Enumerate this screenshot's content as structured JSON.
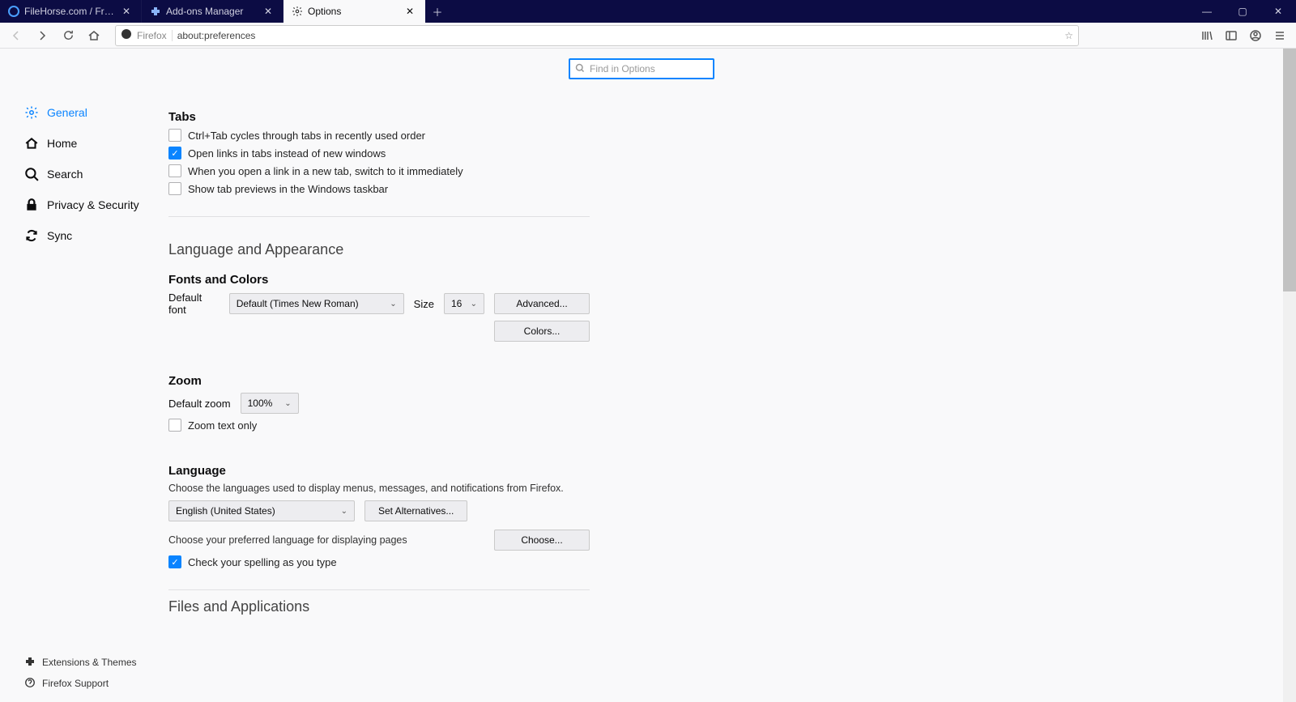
{
  "tabs": [
    {
      "label": "FileHorse.com / Free Software …",
      "active": false
    },
    {
      "label": "Add-ons Manager",
      "active": false
    },
    {
      "label": "Options",
      "active": true
    }
  ],
  "urlbar": {
    "identity": "Firefox",
    "url": "about:preferences"
  },
  "search": {
    "placeholder": "Find in Options"
  },
  "sidebar": [
    {
      "label": "General",
      "active": true
    },
    {
      "label": "Home"
    },
    {
      "label": "Search"
    },
    {
      "label": "Privacy & Security"
    },
    {
      "label": "Sync"
    }
  ],
  "bottomlinks": [
    {
      "label": "Extensions & Themes"
    },
    {
      "label": "Firefox Support"
    }
  ],
  "tabs_section": {
    "title": "Tabs",
    "items": [
      {
        "checked": false,
        "label": "Ctrl+Tab cycles through tabs in recently used order"
      },
      {
        "checked": true,
        "label": "Open links in tabs instead of new windows"
      },
      {
        "checked": false,
        "label": "When you open a link in a new tab, switch to it immediately"
      },
      {
        "checked": false,
        "label": "Show tab previews in the Windows taskbar"
      }
    ]
  },
  "lang_appearance": {
    "title": "Language and Appearance"
  },
  "fonts": {
    "title": "Fonts and Colors",
    "default_font_label": "Default font",
    "default_font_value": "Default (Times New Roman)",
    "size_label": "Size",
    "size_value": "16",
    "advanced": "Advanced...",
    "colors": "Colors..."
  },
  "zoom": {
    "title": "Zoom",
    "default_zoom_label": "Default zoom",
    "default_zoom_value": "100%",
    "text_only_checked": false,
    "text_only_label": "Zoom text only"
  },
  "language": {
    "title": "Language",
    "desc1": "Choose the languages used to display menus, messages, and notifications from Firefox.",
    "lang_value": "English (United States)",
    "set_alt": "Set Alternatives...",
    "desc2": "Choose your preferred language for displaying pages",
    "choose": "Choose...",
    "spell_checked": true,
    "spell_label": "Check your spelling as you type"
  },
  "files": {
    "title": "Files and Applications"
  }
}
